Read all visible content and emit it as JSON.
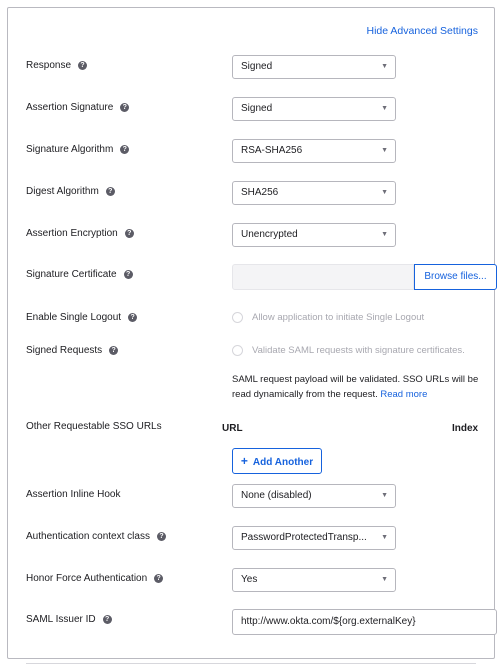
{
  "header": {
    "advanced_link": "Hide Advanced Settings"
  },
  "fields": {
    "response": {
      "label": "Response",
      "value": "Signed"
    },
    "assertion_signature": {
      "label": "Assertion Signature",
      "value": "Signed"
    },
    "signature_algorithm": {
      "label": "Signature Algorithm",
      "value": "RSA-SHA256"
    },
    "digest_algorithm": {
      "label": "Digest Algorithm",
      "value": "SHA256"
    },
    "assertion_encryption": {
      "label": "Assertion Encryption",
      "value": "Unencrypted"
    },
    "signature_certificate": {
      "label": "Signature Certificate",
      "button": "Browse files..."
    },
    "single_logout": {
      "label": "Enable Single Logout",
      "checkbox_label": "Allow application to initiate Single Logout"
    },
    "signed_requests": {
      "label": "Signed Requests",
      "checkbox_label": "Validate SAML requests with signature certificates.",
      "note": "SAML request payload will be validated. SSO URLs will be read dynamically from the request.",
      "read_more": "Read more"
    },
    "sso_urls": {
      "label": "Other Requestable SSO URLs",
      "col_url": "URL",
      "col_index": "Index",
      "add_button": "Add Another"
    },
    "inline_hook": {
      "label": "Assertion Inline Hook",
      "value": "None (disabled)"
    },
    "auth_context": {
      "label": "Authentication context class",
      "value": "PasswordProtectedTransp..."
    },
    "force_auth": {
      "label": "Honor Force Authentication",
      "value": "Yes"
    },
    "issuer_id": {
      "label": "SAML Issuer ID",
      "value": "http://www.okta.com/${org.externalKey}"
    }
  },
  "icons": {
    "help": "help-circle-icon",
    "caret": "caret-down-icon",
    "plus": "plus-icon"
  },
  "colors": {
    "link": "#1662dd",
    "text": "#1d1d21",
    "help_bg": "#5c5c66"
  }
}
